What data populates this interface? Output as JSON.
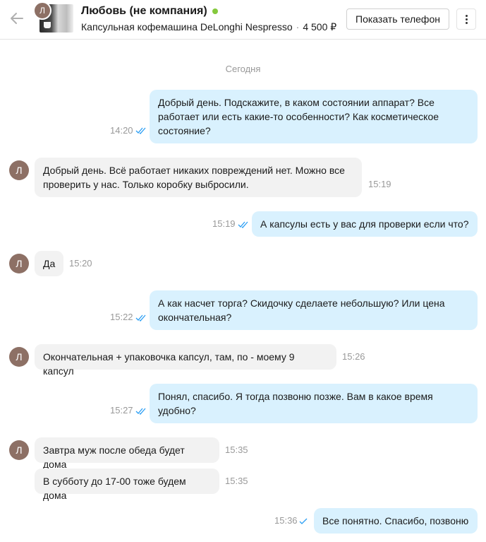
{
  "header": {
    "avatar_letter": "Л",
    "name": "Любовь (не компания)",
    "item_title": "Капсульная кофемашина DeLonghi Nespresso",
    "item_price": "4 500 ₽",
    "separator": "·",
    "phone_button": "Показать телефон"
  },
  "chat": {
    "date_label": "Сегодня",
    "messages": [
      {
        "direction": "out",
        "text": "Добрый день. Подскажите, в каком состоянии аппарат? Все работает или есть какие-то особенности? Как косметическое состояние?",
        "time": "14:20",
        "status": "read"
      },
      {
        "direction": "in",
        "text": "Добрый день. Всё работает никаких повреждений нет. Можно все проверить у нас. Только коробку выбросили.",
        "time": "15:19",
        "avatar": "Л"
      },
      {
        "direction": "out",
        "text": "А капсулы есть у вас для проверки если что?",
        "time": "15:19",
        "status": "read"
      },
      {
        "direction": "in",
        "text": "Да",
        "time": "15:20",
        "avatar": "Л"
      },
      {
        "direction": "out",
        "text": "А как насчет торга? Скидочку сделаете небольшую? Или цена окончательная?",
        "time": "15:22",
        "status": "read"
      },
      {
        "direction": "in",
        "text": "Окончательная + упаковочка капсул, там, по - моему 9 капсул",
        "time": "15:26",
        "avatar": "Л"
      },
      {
        "direction": "out",
        "text": "Понял, спасибо. Я тогда позвоню позже. Вам в какое время удобно?",
        "time": "15:27",
        "status": "read"
      },
      {
        "direction": "in",
        "text": "Завтра муж после обеда будет дома",
        "time": "15:35",
        "avatar": "Л"
      },
      {
        "direction": "in",
        "text": "В субботу до 17-00 тоже будем дома",
        "time": "15:35"
      },
      {
        "direction": "out",
        "text": "Все понятно. Спасибо, позвоню",
        "time": "15:36",
        "status": "sent"
      }
    ]
  },
  "colors": {
    "outgoing_bubble": "#d9f1fe",
    "incoming_bubble": "#f2f2f2",
    "check_color": "#2a9ef4",
    "online": "#85c93d",
    "avatar_bg": "#8d7065"
  },
  "icons": {
    "back": "arrow-left-icon",
    "more": "dots-vertical-icon",
    "read": "double-check-icon",
    "sent": "single-check-icon"
  }
}
